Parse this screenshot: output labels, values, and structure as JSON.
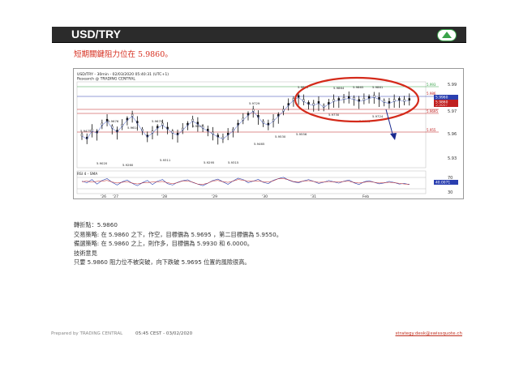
{
  "header": {
    "title": "USD/TRY",
    "badge_icon": "up-arrow-icon",
    "badge_color": "#3aa34a"
  },
  "subtitle": "短期關鍵阻力位在  5.9860。",
  "chart_data": {
    "type": "line",
    "title": "USD/TRY - 30min - 02/03/2020 05:40:31 (UTC+1)",
    "subtitle": "Research @ TRADING CENTRAL",
    "x_ticks": [
      "'26",
      "'27",
      "'28",
      "'29",
      "'30",
      "'31",
      "Feb"
    ],
    "y_ticks": [
      "5.99",
      "5.97",
      "5.96",
      "5.93"
    ],
    "y_range": [
      5.915,
      6.005
    ],
    "price_tags": [
      {
        "value": "5.9960",
        "color": "#2a3fb0"
      },
      {
        "value": "5.9807",
        "color": "#c02020"
      },
      {
        "value": "5.9860",
        "color": "#c02020"
      }
    ],
    "levels": [
      {
        "label": "5.993",
        "color": "#3aa34a"
      },
      {
        "label": "5.986",
        "color": "#c02020"
      },
      {
        "label": "5.9695",
        "color": "#c02020"
      },
      {
        "label": "5.955",
        "color": "#c02020"
      }
    ],
    "annotations": [
      "5.9475",
      "5.9676",
      "5.9614",
      "5.9670",
      "5.9627",
      "5.9729",
      "5.9873",
      "5.9864",
      "5.9865",
      "5.9861",
      "5.9020",
      "5.9260",
      "5.9311",
      "5.9295",
      "5.9315",
      "5.9465",
      "5.9530",
      "5.9556",
      "5.9730",
      "5.9651",
      "5.9724"
    ],
    "close": [
      5.947,
      5.944,
      5.952,
      5.95,
      5.958,
      5.962,
      5.955,
      5.951,
      5.957,
      5.963,
      5.967,
      5.96,
      5.952,
      5.946,
      5.95,
      5.955,
      5.958,
      5.954,
      5.95,
      5.948,
      5.953,
      5.958,
      5.962,
      5.959,
      5.955,
      5.952,
      5.949,
      5.946,
      5.944,
      5.948,
      5.952,
      5.958,
      5.963,
      5.968,
      5.972,
      5.966,
      5.96,
      5.958,
      5.962,
      5.967,
      5.972,
      5.978,
      5.983,
      5.986,
      5.982,
      5.979,
      5.978,
      5.98,
      5.976,
      5.979,
      5.982,
      5.983,
      5.984,
      5.985,
      5.984,
      5.982,
      5.983,
      5.985,
      5.986,
      5.984,
      5.981,
      5.98,
      5.982,
      5.983,
      5.982,
      5.983
    ],
    "rsi_label": "RSI 4 - SMA",
    "rsi_ticks": [
      "70",
      "30"
    ],
    "rsi_tag": "40.0071",
    "rsi": [
      55,
      48,
      62,
      42,
      58,
      66,
      50,
      38,
      52,
      60,
      45,
      35,
      48,
      58,
      40,
      55,
      62,
      44,
      38,
      50,
      57,
      61,
      49,
      42,
      35,
      46,
      58,
      64,
      52,
      41,
      56,
      68,
      62,
      48,
      55,
      63,
      50,
      44,
      59,
      66,
      72,
      60,
      52,
      48,
      56,
      62,
      54,
      45,
      50,
      58,
      52,
      46,
      55,
      60,
      48,
      40,
      52,
      57,
      50,
      43,
      47,
      54,
      49,
      42,
      45,
      40
    ]
  },
  "notes": [
    "轉折點：5.9860",
    "交易策略: 在 5.9860 之下，作空，目標價為  5.9695 ，第二目標價為  5.9550。",
    "備選策略: 在 5.9860 之上，則作多，目標價為  5.9930 和 6.0000。",
    "技術意見",
    "只要 5.9860 阻力位不被突破，向下跌破  5.9695 位置的風險很高。"
  ],
  "footer": {
    "prepared": "Prepared by TRADING CENTRAL",
    "time": "05:45 CEST - 03/02/2020",
    "email": "strategy.desk@swissquote.ch"
  }
}
